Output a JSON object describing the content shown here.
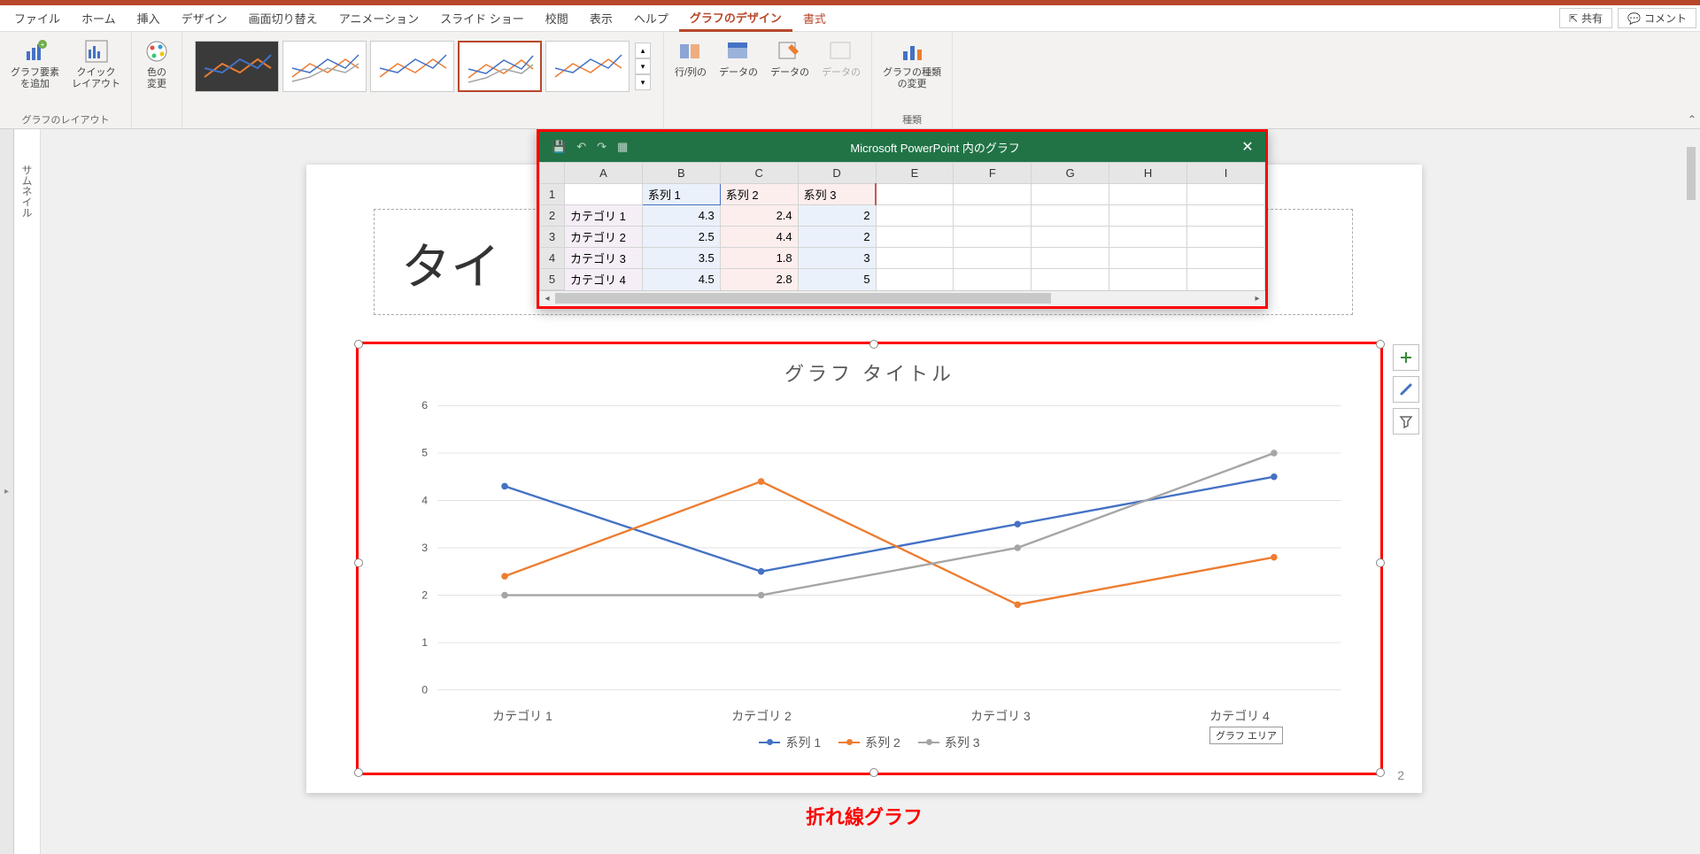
{
  "menu": {
    "tabs": [
      "ファイル",
      "ホーム",
      "挿入",
      "デザイン",
      "画面切り替え",
      "アニメーション",
      "スライド ショー",
      "校閲",
      "表示",
      "ヘルプ",
      "グラフのデザイン",
      "書式"
    ],
    "active": "グラフのデザイン",
    "share": "共有",
    "comment": "コメント"
  },
  "ribbon": {
    "group1": {
      "label": "グラフのレイアウト",
      "btn1": "グラフ要素\nを追加",
      "btn2": "クイック\nレイアウト"
    },
    "group2": {
      "btn": "色の\n変更"
    },
    "group3": {
      "btn1": "行/列の",
      "btn2": "データの",
      "btn3": "データの",
      "btn4": "データの"
    },
    "group4": {
      "label": "種類",
      "btn": "グラフの種類\nの変更"
    }
  },
  "datawin": {
    "title": "Microsoft PowerPoint 内のグラフ",
    "cols": [
      "A",
      "B",
      "C",
      "D",
      "E",
      "F",
      "G",
      "H",
      "I"
    ],
    "headers": [
      "",
      "系列 1",
      "系列 2",
      "系列 3"
    ],
    "rows": [
      {
        "n": "1"
      },
      {
        "n": "2",
        "cat": "カテゴリ 1",
        "v": [
          "4.3",
          "2.4",
          "2"
        ]
      },
      {
        "n": "3",
        "cat": "カテゴリ 2",
        "v": [
          "2.5",
          "4.4",
          "2"
        ]
      },
      {
        "n": "4",
        "cat": "カテゴリ 3",
        "v": [
          "3.5",
          "1.8",
          "3"
        ]
      },
      {
        "n": "5",
        "cat": "カテゴリ 4",
        "v": [
          "4.5",
          "2.8",
          "5"
        ]
      }
    ]
  },
  "slide": {
    "titlePlaceholder": "タイ",
    "pagenum": "2"
  },
  "chart_data": {
    "type": "line",
    "title": "グラフ タイトル",
    "categories": [
      "カテゴリ 1",
      "カテゴリ 2",
      "カテゴリ 3",
      "カテゴリ 4"
    ],
    "series": [
      {
        "name": "系列 1",
        "values": [
          4.3,
          2.5,
          3.5,
          4.5
        ],
        "color": "#4472c4"
      },
      {
        "name": "系列 2",
        "values": [
          2.4,
          4.4,
          1.8,
          2.8
        ],
        "color": "#ed7d31"
      },
      {
        "name": "系列 3",
        "values": [
          2,
          2,
          3,
          5
        ],
        "color": "#a5a5a5"
      }
    ],
    "ylim": [
      0,
      6
    ],
    "yticks": [
      0,
      1,
      2,
      3,
      4,
      5,
      6
    ],
    "tooltip": "グラフ エリア"
  },
  "annotation": "折れ線グラフ",
  "thumbnail_label": "サムネイル"
}
